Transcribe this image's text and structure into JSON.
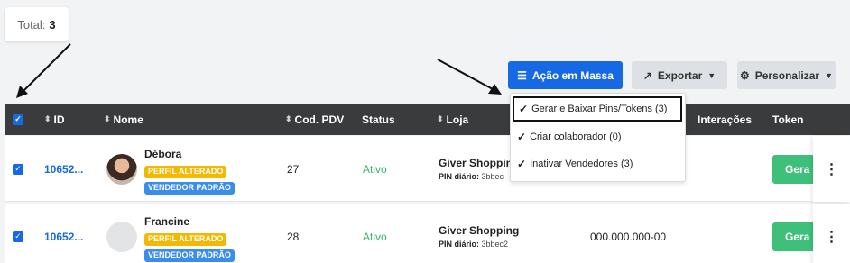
{
  "summary": {
    "total_label": "Total:",
    "total_value": "3"
  },
  "toolbar": {
    "mass_action_label": "Ação em Massa",
    "export_label": "Exportar",
    "customize_label": "Personalizar"
  },
  "mass_menu": {
    "items": [
      {
        "label": "Gerar e Baixar Pins/Tokens (3)"
      },
      {
        "label": "Criar colaborador (0)"
      },
      {
        "label": "Inativar Vendedores (3)"
      }
    ]
  },
  "table": {
    "columns": {
      "id": "ID",
      "name": "Nome",
      "pdv": "Cod. PDV",
      "status": "Status",
      "store": "Loja",
      "interactions": "Interações",
      "token": "Token"
    },
    "rows": [
      {
        "id": "10652...",
        "name": "Débora",
        "badge_profile": "PERFIL ALTERADO",
        "badge_seller": "VENDEDOR PADRÃO",
        "pdv": "27",
        "status": "Ativo",
        "store": "Giver Shopping",
        "pin_label": "PIN diário:",
        "pin_value": "3bbec",
        "cpf": "",
        "token_button": "Gera"
      },
      {
        "id": "10652...",
        "name": "Francine",
        "badge_profile": "PERFIL ALTERADO",
        "badge_seller": "VENDEDOR PADRÃO",
        "pdv": "28",
        "status": "Ativo",
        "store": "Giver Shopping",
        "pin_label": "PIN diário:",
        "pin_value": "3bbec2",
        "cpf": "000.000.000-00",
        "token_button": "Gera"
      }
    ]
  },
  "colors": {
    "primary": "#1668e3",
    "header_bg": "#3a3b3c",
    "success": "#3ec07a",
    "badge_yellow": "#f5b800",
    "badge_blue": "#3a8de8"
  },
  "icons": [
    "checklist-icon",
    "share-icon",
    "chevron-down-icon",
    "gear-icon",
    "check-icon",
    "sort-icon",
    "kebab-icon"
  ]
}
